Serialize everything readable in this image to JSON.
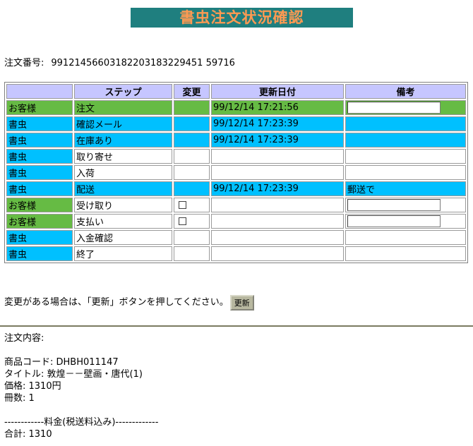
{
  "page_title": "書虫注文状況確認",
  "order": {
    "label": "注文番号:",
    "number": "99121456603182203183229451 59716"
  },
  "table": {
    "headers": [
      "",
      "ステップ",
      "変更",
      "更新日付",
      "備考"
    ],
    "rows": [
      {
        "actor": "お客様",
        "step": "注文",
        "date": "99/12/14 17:21:56",
        "note": "",
        "style": "green",
        "change": "",
        "input": true
      },
      {
        "actor": "書虫",
        "step": "確認メール",
        "date": "99/12/14 17:23:39",
        "note": "",
        "style": "cyan"
      },
      {
        "actor": "書虫",
        "step": "在庫あり",
        "date": "99/12/14 17:23:39",
        "note": "",
        "style": "cyan"
      },
      {
        "actor": "書虫",
        "step": "取り寄せ",
        "date": "",
        "note": "",
        "style": "white"
      },
      {
        "actor": "書虫",
        "step": "入荷",
        "date": "",
        "note": "",
        "style": "white"
      },
      {
        "actor": "書虫",
        "step": "配送",
        "date": "99/12/14 17:23:39",
        "note": "郵送で",
        "style": "cyan"
      },
      {
        "actor": "お客様",
        "step": "受け取り",
        "date": "",
        "note": "",
        "style": "white",
        "checkbox": true,
        "input": true
      },
      {
        "actor": "お客様",
        "step": "支払い",
        "date": "",
        "note": "",
        "style": "white",
        "checkbox": true,
        "input": true
      },
      {
        "actor": "書虫",
        "step": "入金確認",
        "date": "",
        "note": "",
        "style": "white"
      },
      {
        "actor": "書虫",
        "step": "終了",
        "date": "",
        "note": "",
        "style": "white"
      }
    ]
  },
  "update": {
    "message": "変更がある場合は、「更新」ボタンを押してください。",
    "button_label": "更新"
  },
  "details": {
    "heading": "注文内容:",
    "product_code": "商品コード: DHBH011147",
    "title": "タイトル: 敦煌－－壁画・唐代(1)",
    "price": "価格: 1310円",
    "quantity": "冊数: 1",
    "fee_header": "------------料金(税送料込み)-------------",
    "total": "合計: 1310"
  }
}
